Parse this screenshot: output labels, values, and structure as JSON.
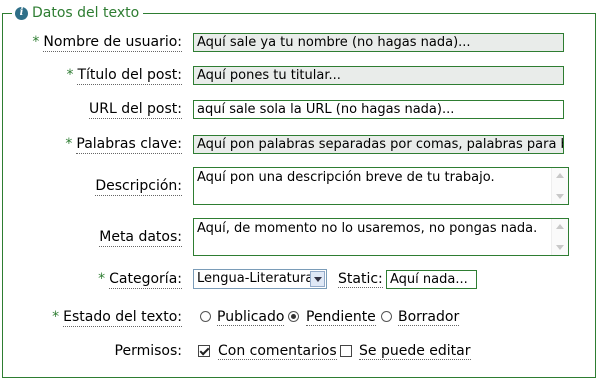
{
  "fieldset": {
    "legend": "Datos del texto",
    "legend_icon": "info-icon"
  },
  "form": {
    "username": {
      "required": "*",
      "label": "Nombre de usuario:",
      "value": "Aquí sale ya tu nombre (no hagas nada)..."
    },
    "post_title": {
      "required": "*",
      "label": "Título del post:",
      "value": "Aquí pones tu titular..."
    },
    "post_url": {
      "label": "URL del post:",
      "value": "aquí sale sola la URL (no hagas nada)..."
    },
    "keywords": {
      "required": "*",
      "label": "Palabras clave:",
      "value": "Aquí pon palabras separadas por comas, palabras para búsq"
    },
    "description": {
      "label": "Descripción:",
      "value": "Aquí pon una descripción breve de tu trabajo."
    },
    "meta": {
      "label": "Meta datos:",
      "value": "Aquí, de momento no lo usaremos, no pongas nada."
    },
    "category": {
      "required": "*",
      "label": "Categoría:",
      "selected": "Lengua-Literatura"
    },
    "static": {
      "label": "Static:",
      "value": "Aquí nada..."
    },
    "status": {
      "required": "*",
      "label": "Estado del texto:",
      "options": [
        "Publicado",
        "Pendiente",
        "Borrador"
      ],
      "selected": "Pendiente"
    },
    "permissions": {
      "label": "Permisos:",
      "options": [
        {
          "label": "Con comentarios",
          "checked": true
        },
        {
          "label": "Se puede editar",
          "checked": false
        }
      ]
    }
  },
  "colors": {
    "accent": "#2e7d32",
    "readonly_bg": "#e9ecea",
    "icon": "#2f6f88"
  }
}
